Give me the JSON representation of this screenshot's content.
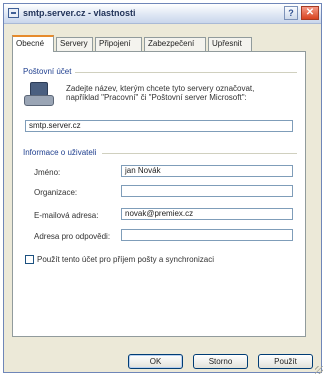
{
  "window": {
    "title": "smtp.server.cz - vlastnosti"
  },
  "titlebar": {
    "help_label": "?",
    "close_label": "✕"
  },
  "tabs": [
    {
      "label": "Obecné",
      "active": true
    },
    {
      "label": "Servery",
      "active": false
    },
    {
      "label": "Připojení",
      "active": false
    },
    {
      "label": "Zabezpečení",
      "active": false
    },
    {
      "label": "Upřesnit",
      "active": false
    }
  ],
  "mail_account": {
    "section_label": "Poštovní účet",
    "description": "Zadejte název, kterým chcete tyto servery označovat, například \"Pracovní\" či \"Poštovní server Microsoft\":",
    "account_name_value": "smtp.server.cz"
  },
  "user_info": {
    "section_label": "Informace o uživateli",
    "fields": [
      {
        "label": "Jméno:",
        "value": "jan Novák"
      },
      {
        "label": "Organizace:",
        "value": ""
      },
      {
        "label": "E-mailová adresa:",
        "value": "novak@premiex.cz"
      },
      {
        "label": "Adresa pro odpovědi:",
        "value": ""
      }
    ]
  },
  "sync_checkbox": {
    "label": "Použít tento účet pro příjem pošty a synchronizaci",
    "checked": false
  },
  "buttons": {
    "ok": "OK",
    "cancel": "Storno",
    "apply": "Použít"
  },
  "colors": {
    "tab_accent": "#e68b2c",
    "group_label": "#1f3f8f",
    "input_border": "#7f9db9",
    "close_button": "#d8421f"
  }
}
